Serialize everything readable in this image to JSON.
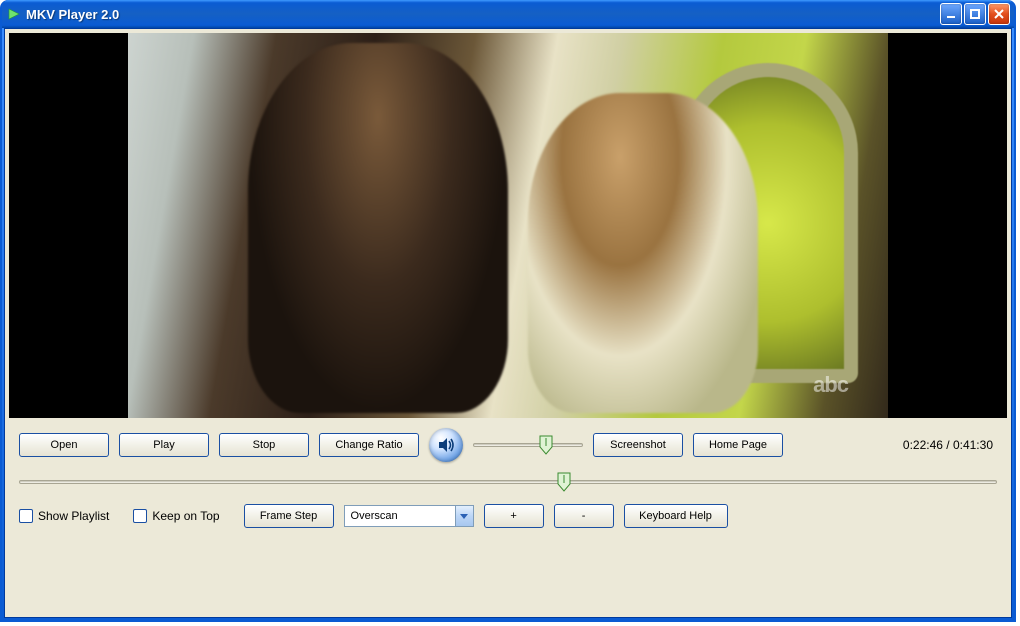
{
  "window": {
    "title": "MKV Player 2.0"
  },
  "video": {
    "watermark": "abc"
  },
  "toolbar": {
    "open": "Open",
    "play": "Play",
    "stop": "Stop",
    "change_ratio": "Change Ratio",
    "screenshot": "Screenshot",
    "home_page": "Home Page"
  },
  "time": {
    "current": "0:22:46",
    "sep": " / ",
    "total": "0:41:30"
  },
  "volume": {
    "percent": 60
  },
  "seek": {
    "percent": 55
  },
  "row2": {
    "show_playlist": "Show Playlist",
    "keep_on_top": "Keep on Top",
    "frame_step": "Frame Step",
    "overscan": "Overscan",
    "plus": "+",
    "minus": "-",
    "keyboard_help": "Keyboard Help"
  }
}
